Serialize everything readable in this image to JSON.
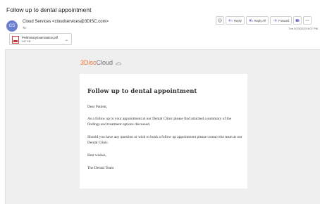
{
  "email": {
    "subject": "Follow up to dental appointment",
    "avatar_initials": "CS",
    "sender": "Cloud Services <cloudservices@3DISC.com>",
    "to_label": "To",
    "datetime": "Tue 5/23/2023 5:07 PM",
    "toolbar": {
      "reply": "Reply",
      "reply_all": "Reply All",
      "forward": "Forward"
    },
    "attachment": {
      "name": "PreliminaryExamination.pdf",
      "size": "187 KB"
    }
  },
  "body": {
    "logo_part1": "3Disc",
    "logo_part2": "Cloud",
    "title": "Follow up to dental appointment",
    "greeting": "Dear Patient,",
    "paragraph1": "As a follow up to your appointment at our Dental Clinic please find attached a summary of the findings and treatment options discussed.",
    "paragraph2": "Should you have any question or wish to book a follow up appointment please contact the team at our Dental Clinic.",
    "closing": "Best wishes,",
    "signature": "The Dental Team"
  },
  "colors": {
    "avatar": "#6b7fd1",
    "logo_accent": "#e8763a",
    "teams_blue": "#4f52b2",
    "canvas_bg": "#efefef"
  },
  "icons": [
    "emoji-icon",
    "reply-icon",
    "reply-all-icon",
    "forward-icon",
    "teams-icon",
    "more-icon",
    "pdf-icon",
    "chevron-down-icon",
    "cloud-icon"
  ]
}
